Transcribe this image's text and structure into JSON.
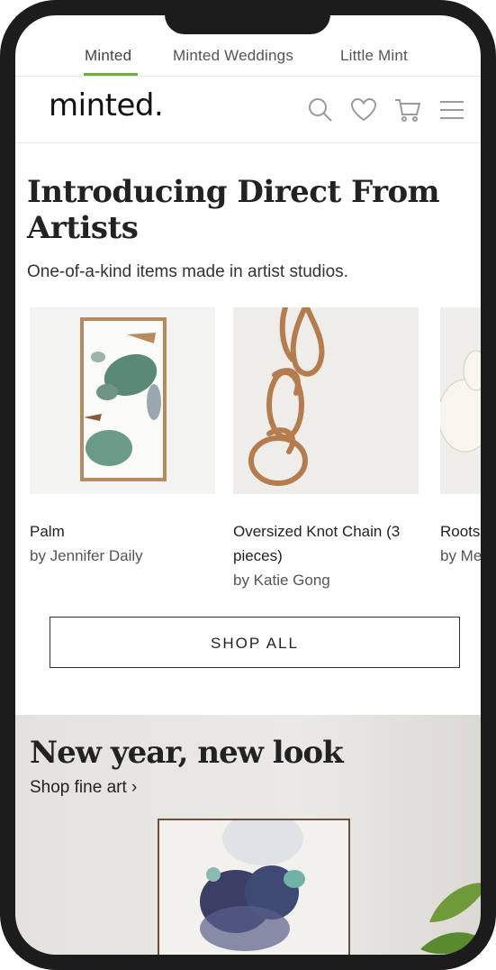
{
  "topnav": {
    "tabs": [
      {
        "label": "Minted",
        "active": true
      },
      {
        "label": "Minted Weddings",
        "active": false
      },
      {
        "label": "Little Mint",
        "active": false
      }
    ],
    "active_color": "#6fae3c"
  },
  "header": {
    "logo": "minted.",
    "icons": [
      "search-icon",
      "heart-icon",
      "cart-icon",
      "menu-icon"
    ]
  },
  "promo": {
    "title": "Introducing Direct From Artists",
    "subtitle": "One-of-a-kind items made in artist studios.",
    "products": [
      {
        "name": "Palm",
        "artist": "by Jennifer Daily"
      },
      {
        "name": "Oversized Knot Chain (3 pieces)",
        "artist": "by Katie Gong"
      },
      {
        "name": "Roots",
        "artist": "by Me"
      }
    ],
    "cta": "SHOP ALL"
  },
  "banner": {
    "title": "New year, new look",
    "link": "Shop fine art ›"
  }
}
